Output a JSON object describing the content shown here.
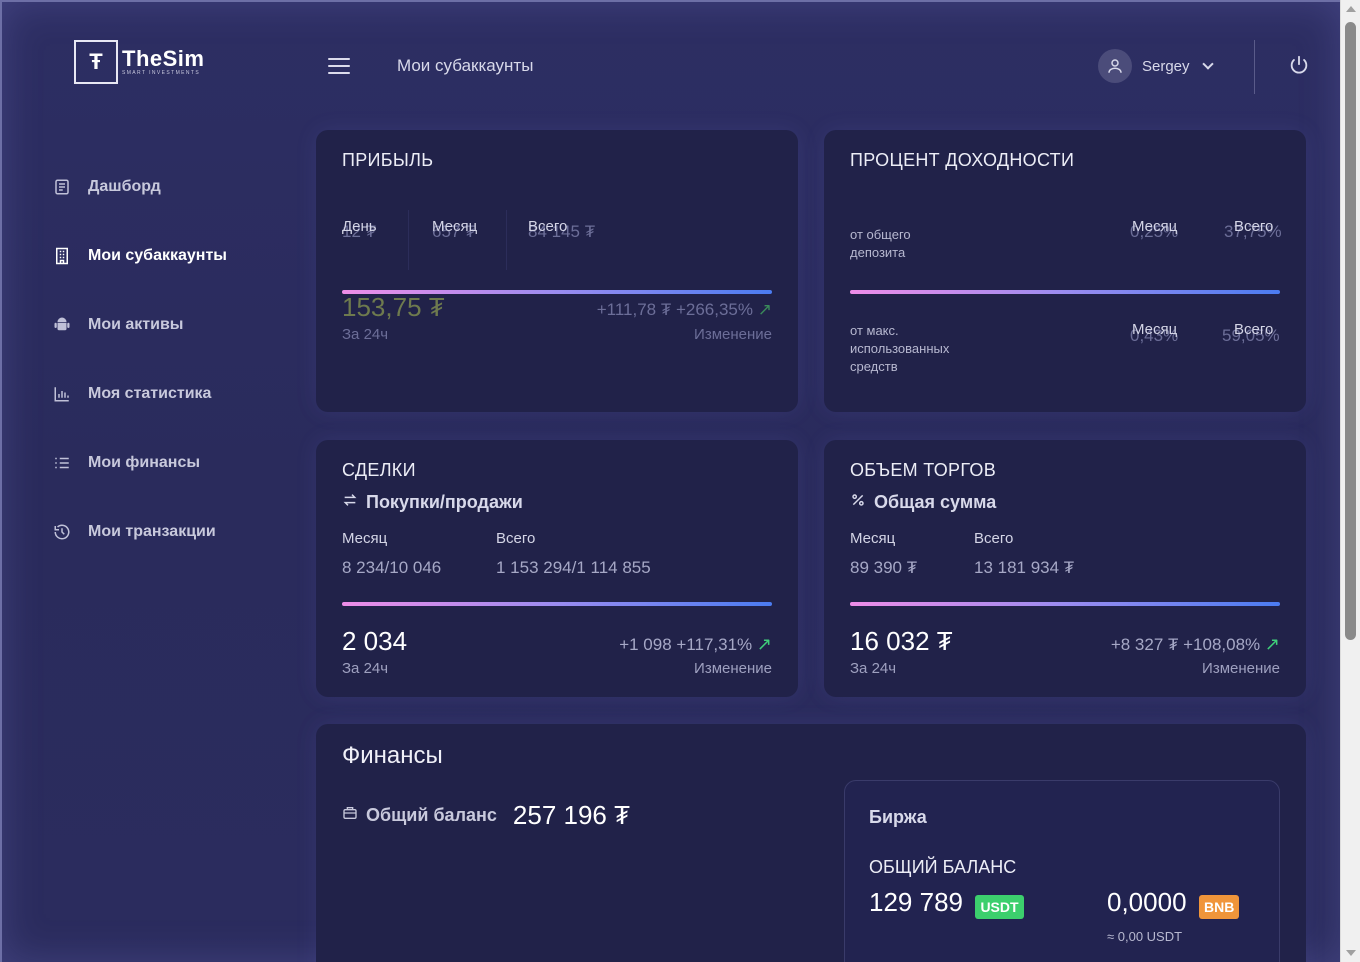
{
  "header": {
    "logo_mark": "Ŧ",
    "logo_name": "TheSim",
    "logo_tagline": "SMART INVESTMENTS",
    "page_title": "Мои субаккаунты",
    "user_name": "Sergey"
  },
  "sidebar": {
    "items": [
      {
        "label": "Дашборд",
        "icon": "document-icon"
      },
      {
        "label": "Мои субаккаунты",
        "icon": "building-icon",
        "active": true
      },
      {
        "label": "Мои активы",
        "icon": "android-icon"
      },
      {
        "label": "Моя статистика",
        "icon": "bar-chart-icon"
      },
      {
        "label": "Мои финансы",
        "icon": "list-icon"
      },
      {
        "label": "Мои транзакции",
        "icon": "history-icon"
      }
    ]
  },
  "profit": {
    "title": "ПРИБЫЛЬ",
    "tab_day": "День",
    "tab_month": "Месяц",
    "tab_total": "Всего",
    "ghost_day": "12 ₮",
    "ghost_month": "657 ₮",
    "ghost_total": "84 145 ₮",
    "value": "153,75 ₮",
    "value_caption": "За 24ч",
    "change": "+111,78 ₮  +266,35%",
    "change_caption": "Изменение"
  },
  "yield": {
    "title": "ПРОЦЕНТ ДОХОДНОСТИ",
    "row1_label": "от общего депозита",
    "row1_month": "Месяц",
    "row1_total": "Всего",
    "row1_ghost_month": "0,25%",
    "row1_ghost_total": "37,75%",
    "row2_label": "от макс. использованных средств",
    "row2_month": "Месяц",
    "row2_total": "Всего",
    "row2_ghost_month": "0,43%",
    "row2_ghost_total": "59,05%"
  },
  "deals": {
    "title": "СДЕЛКИ",
    "subtitle": "Покупки/продажи",
    "month_label": "Месяц",
    "total_label": "Всего",
    "month_value": "8 234/10 046",
    "total_value": "1 153 294/1 114 855",
    "value": "2 034",
    "value_caption": "За 24ч",
    "change": "+1 098  +117,31%",
    "change_caption": "Изменение"
  },
  "volume": {
    "title": "ОБЪЕМ ТОРГОВ",
    "subtitle": "Общая сумма",
    "month_label": "Месяц",
    "total_label": "Всего",
    "month_value": "89 390 ₮",
    "total_value": "13 181 934 ₮",
    "value": "16 032 ₮",
    "value_caption": "За 24ч",
    "change": "+8 327 ₮  +108,08%",
    "change_caption": "Изменение"
  },
  "finance": {
    "title": "Финансы",
    "balance_label": "Общий баланс",
    "balance_value": "257 196 ₮",
    "exchange_title": "Биржа",
    "exchange_subtitle": "ОБЩИЙ БАЛАНС",
    "usdt_value": "129 789",
    "usdt_badge": "USDT",
    "bnb_value": "0,0000",
    "bnb_badge": "BNB",
    "bnb_note": "≈ 0,00 USDT"
  },
  "colors": {
    "usdt": "#3ccf6d",
    "bnb": "#f0953a",
    "up_arrow": "#3fcf7a"
  }
}
